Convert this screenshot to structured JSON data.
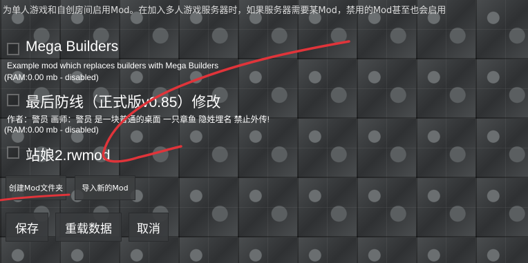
{
  "notice": "为单人游戏和自创房间启用Mod。在加入多人游戏服务器时，如果服务器需要某Mod，禁用的Mod甚至也会启用",
  "mods": [
    {
      "title": "Mega Builders",
      "description": "Example mod which replaces builders with Mega Builders",
      "ram": "(RAM:0.00 mb - disabled)",
      "checked": false
    },
    {
      "title": "最后防线（正式版v0.85）修改",
      "description": "作者：警员 画师：警员 是一块普通的桌面 一只章鱼 隐姓埋名 禁止外传!",
      "ram": "(RAM:0.00 mb - disabled)",
      "checked": false
    },
    {
      "title": "站娘2.rwmod",
      "description": "",
      "ram": "",
      "checked": false
    }
  ],
  "buttons": {
    "create_folder": "创建Mod文件夹",
    "import_mod": "导入新的Mod",
    "save": "保存",
    "reload": "重载数据",
    "cancel": "取消"
  },
  "colors": {
    "scribble": "#e0343a",
    "text": "#ffffff"
  }
}
